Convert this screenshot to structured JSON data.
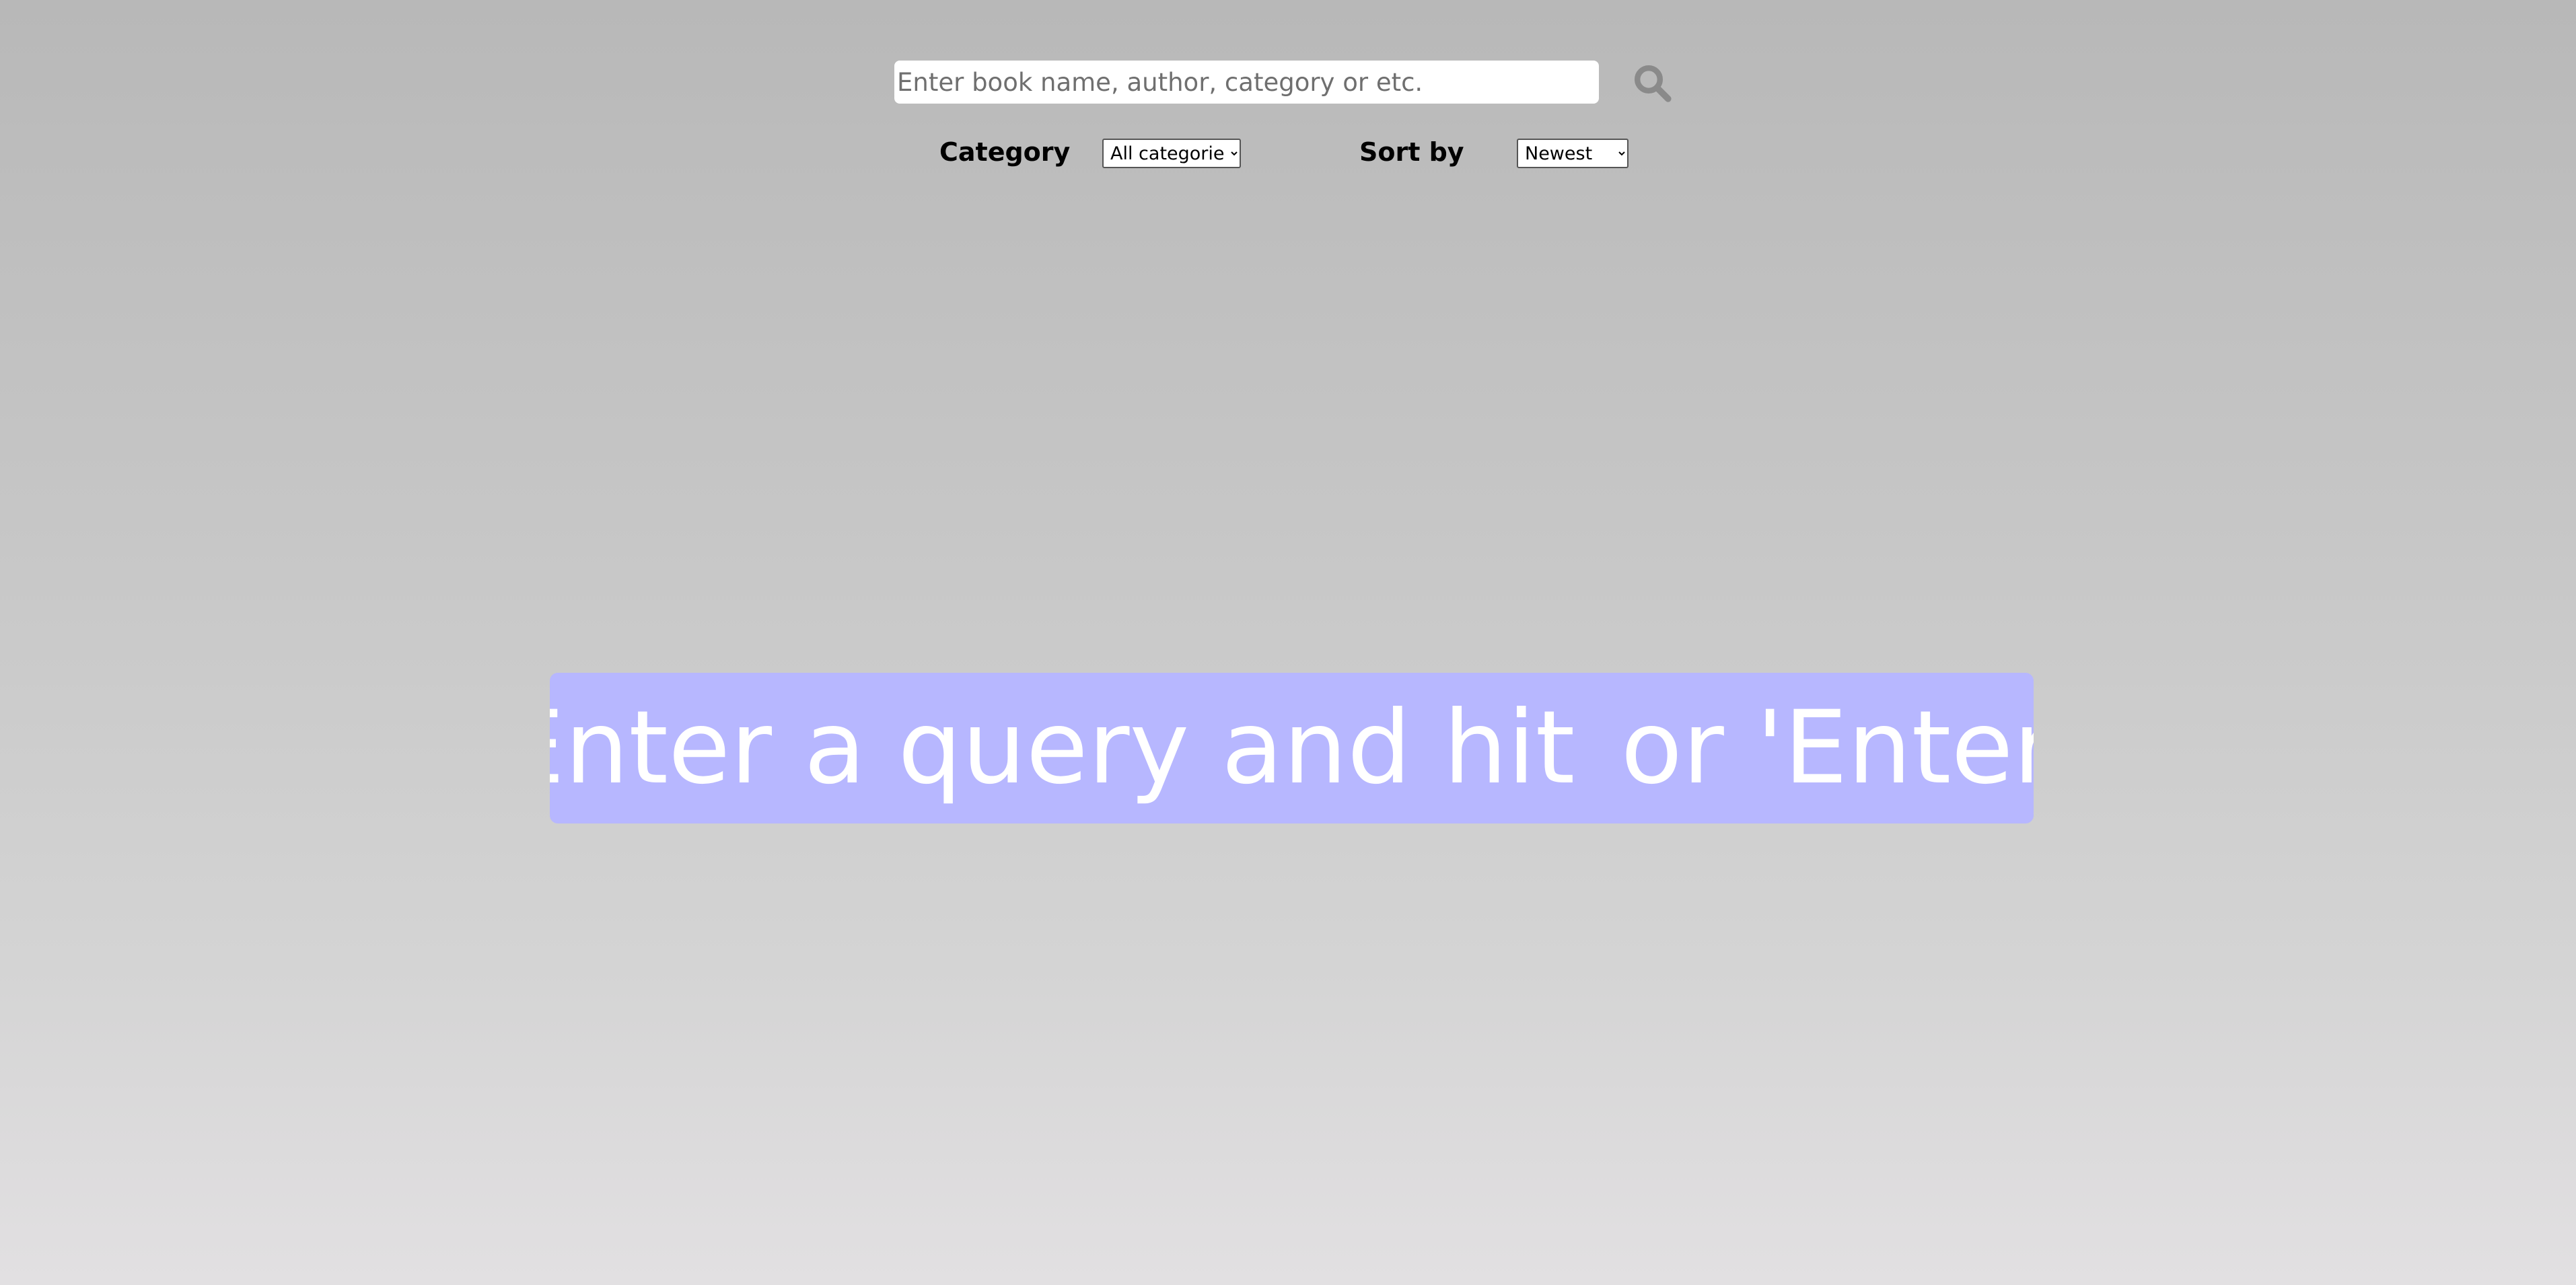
{
  "search": {
    "placeholder": "Enter book name, author, category or etc.",
    "value": "",
    "button_icon": "search-icon"
  },
  "filters": {
    "category_label": "Category",
    "category_selected": "All categories",
    "sort_label": "Sort by",
    "sort_selected": "Newest"
  },
  "hint": {
    "text_before": "Enter a query and hit",
    "icon": "search-icon",
    "text_after": "or 'Enter'"
  },
  "colors": {
    "background_top": "#b8b8b8",
    "background_bottom": "#e2e0e2",
    "hint_banner": "#b7b7ff",
    "search_icon": "#8a8a8a"
  }
}
